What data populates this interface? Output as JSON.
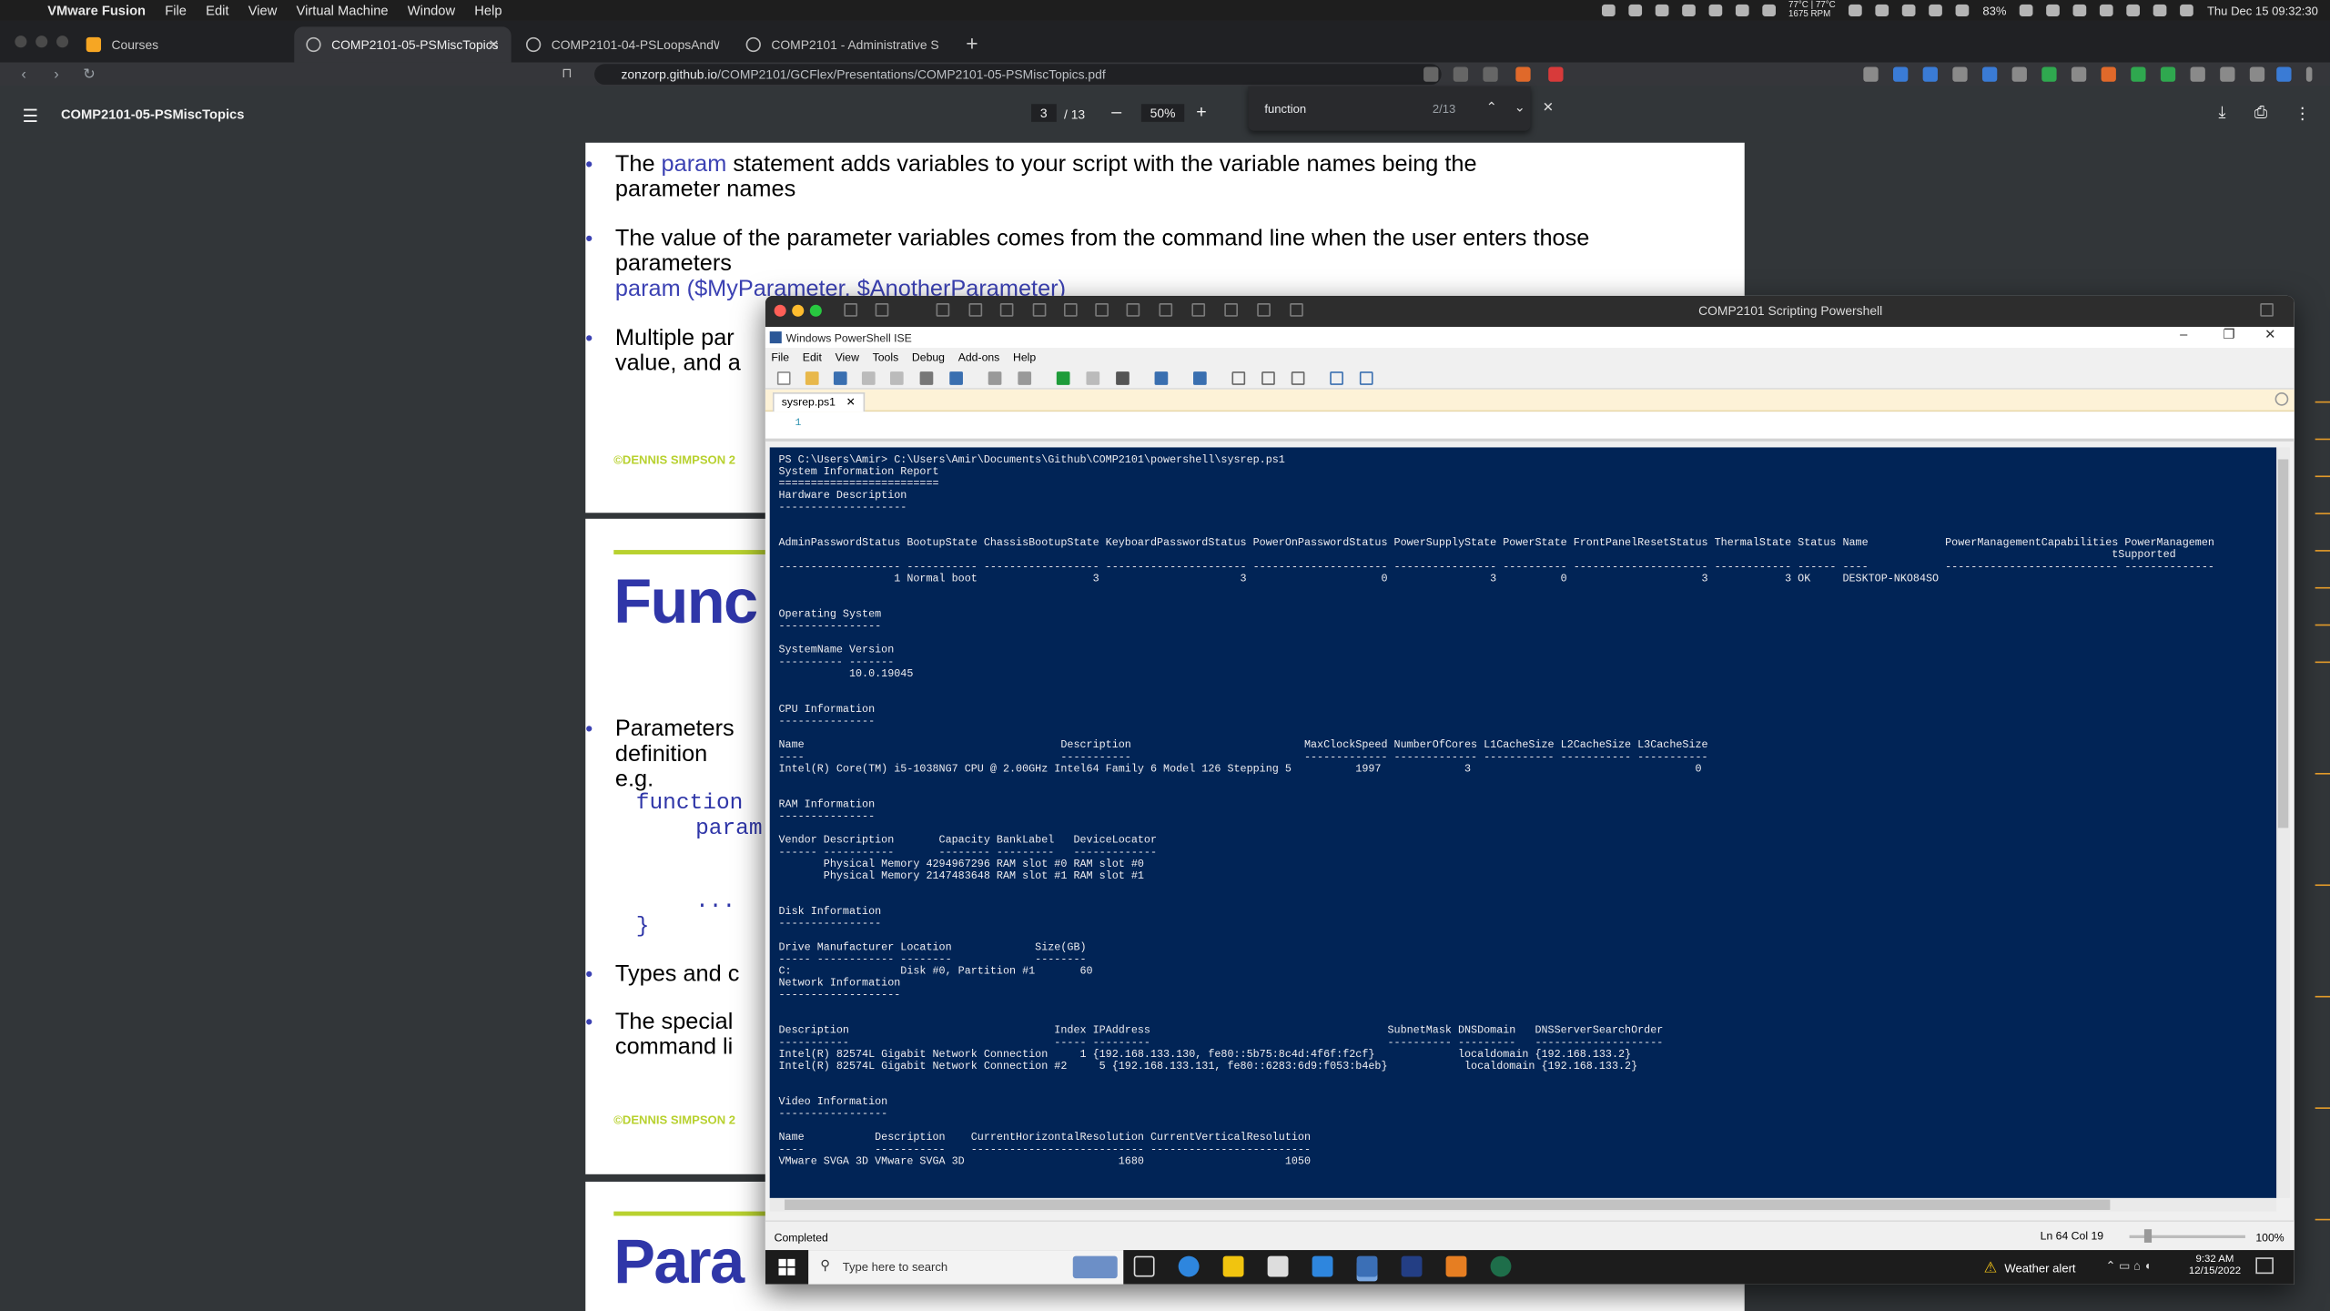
{
  "menubar": {
    "app": "VMware Fusion",
    "items": [
      "File",
      "Edit",
      "View",
      "Virtual Machine",
      "Window",
      "Help"
    ],
    "temp": "77°C | 77°C",
    "rpm": "1675 RPM",
    "battery": "83%",
    "datetime": "Thu Dec 15  09:32:30"
  },
  "browser": {
    "tabs": [
      {
        "label": "Courses"
      },
      {
        "label": "COMP2101-05-PSMiscTopics"
      },
      {
        "label": "COMP2101-04-PSLoopsAndWMI"
      },
      {
        "label": "COMP2101 - Administrative Shell S"
      }
    ],
    "url_domain": "zonzorp.github.io",
    "url_path": "/COMP2101/GCFlex/Presentations/COMP2101-05-PSMiscTopics.pdf"
  },
  "pdf": {
    "title": "COMP2101-05-PSMiscTopics",
    "page": "3",
    "page_total": "/ 13",
    "zoom": "50%",
    "find_query": "function",
    "find_count": "2/13"
  },
  "slides": {
    "p1_b1_a": "The ",
    "p1_b1_kw": "param",
    "p1_b1_b": " statement adds variables to your script with the variable names being the",
    "p1_b1_c": "parameter names",
    "p1_b2_a": "The value of the parameter variables comes from the command line when the user enters those",
    "p1_b2_b": "parameters",
    "p1_b2_code": "param ($MyParameter, $AnotherParameter)",
    "p1_b3_a": "Multiple par",
    "p1_b3_b": "value, and a",
    "footer": "©DENNIS SIMPSON 2",
    "p2_title": "Func",
    "p2_b1_a": "Parameters",
    "p2_b1_b": "definition",
    "p2_b1_c": "e.g.",
    "p2_code1": "function",
    "p2_code2": "param",
    "p2_code3": "...",
    "p2_code4": "}",
    "p2_b2": "Types and c",
    "p2_b3_a": "The special",
    "p2_b3_b": "command li",
    "p3_title": "Para"
  },
  "vm": {
    "title": "COMP2101 Scripting Powershell",
    "ise_title": "Windows PowerShell ISE",
    "menu": [
      "File",
      "Edit",
      "View",
      "Tools",
      "Debug",
      "Add-ons",
      "Help"
    ],
    "file_tab": "sysrep.ps1",
    "line_num": "1",
    "status": "Completed",
    "cursor": "Ln 64  Col 19",
    "zoom": "100%"
  },
  "console_lines": [
    "PS C:\\Users\\Amir> C:\\Users\\Amir\\Documents\\Github\\COMP2101\\powershell\\sysrep.ps1",
    "System Information Report",
    "=========================",
    "Hardware Description",
    "--------------------",
    "",
    "",
    "AdminPasswordStatus BootupState ChassisBootupState KeyboardPasswordStatus PowerOnPasswordStatus PowerSupplyState PowerState FrontPanelResetStatus ThermalState Status Name            PowerManagementCapabilities PowerManagemen",
    "                                                                                                                                                                                                                tSupported",
    "------------------- ----------- ------------------ ---------------------- --------------------- ---------------- ---------- --------------------- ------------ ------ ----            --------------------------- --------------",
    "                  1 Normal boot                  3                      3                     0                3          0                     3            3 OK     DESKTOP-NKO84SO",
    "",
    "",
    "Operating System",
    "----------------",
    "",
    "SystemName Version",
    "---------- -------",
    "           10.0.19045",
    "",
    "",
    "CPU Information",
    "---------------",
    "",
    "Name                                        Description                           MaxClockSpeed NumberOfCores L1CacheSize L2CacheSize L3CacheSize",
    "----                                        -----------                           ------------- ------------- ----------- ----------- -----------",
    "Intel(R) Core(TM) i5-1038NG7 CPU @ 2.00GHz Intel64 Family 6 Model 126 Stepping 5          1997             3                                   0",
    "",
    "",
    "RAM Information",
    "---------------",
    "",
    "Vendor Description       Capacity BankLabel   DeviceLocator",
    "------ -----------       -------- ---------   -------------",
    "       Physical Memory 4294967296 RAM slot #0 RAM slot #0",
    "       Physical Memory 2147483648 RAM slot #1 RAM slot #1",
    "",
    "",
    "Disk Information",
    "----------------",
    "",
    "Drive Manufacturer Location             Size(GB)",
    "----- ------------ --------             --------",
    "C:                 Disk #0, Partition #1       60",
    "Network Information",
    "-------------------",
    "",
    "",
    "Description                                Index IPAddress                                     SubnetMask DNSDomain   DNSServerSearchOrder",
    "-----------                                ----- ---------                                     ---------- ---------   --------------------",
    "Intel(R) 82574L Gigabit Network Connection     1 {192.168.133.130, fe80::5b75:8c4d:4f6f:f2cf}             localdomain {192.168.133.2}",
    "Intel(R) 82574L Gigabit Network Connection #2     5 {192.168.133.131, fe80::6283:6d9:f053:b4eb}            localdomain {192.168.133.2}",
    "",
    "",
    "Video Information",
    "-----------------",
    "",
    "Name           Description    CurrentHorizontalResolution CurrentVerticalResolution",
    "----           -----------    --------------------------- -------------------------",
    "VMware SVGA 3D VMware SVGA 3D                        1680                      1050"
  ],
  "taskbar": {
    "search_placeholder": "Type here to search",
    "weather": "Weather alert",
    "time": "9:32 AM",
    "date": "12/15/2022"
  },
  "colors": {
    "console_bg": "#012456",
    "accent_blue": "#3b41b3",
    "slide_green": "#b8d12f"
  }
}
